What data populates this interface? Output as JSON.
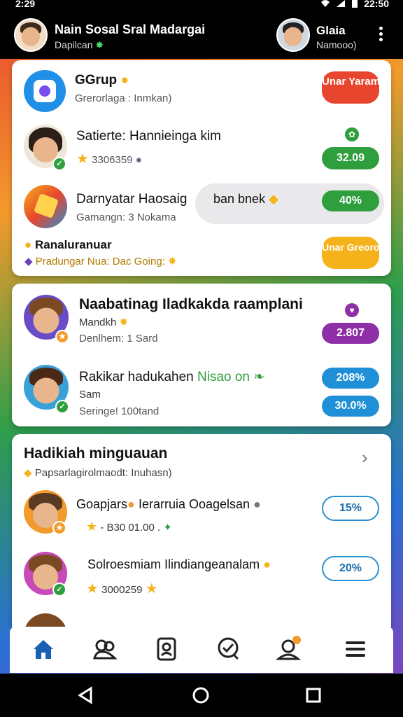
{
  "status": {
    "time": "2:29",
    "clock": "22:50"
  },
  "header": {
    "title": "Nain Sosal Sral Madargai",
    "subtitle": "Dapilcan",
    "user_name": "Glaia",
    "user_sub": "Namooo)"
  },
  "card1": {
    "rows": [
      {
        "title": "GGrup",
        "sub": "Grerorlaga : Inmkan)",
        "pill": "Unar Yarame",
        "pill_color": "#e8452e"
      },
      {
        "title": "Satierte: Hannieinga kim",
        "sub": "3306359",
        "pill": "32.09",
        "pill_color": "#2f9e3c"
      },
      {
        "title": "Darnyatar Haosaig",
        "bubble": "ban bnek",
        "sub": "Gamangn: 3 Nokama",
        "pill": "40%",
        "pill_color": "#2f9e3c"
      }
    ],
    "footer": {
      "title": "Ranaluranuar",
      "sub": "Pradungar Nua: Dac Going:",
      "pill": "Unar Greoro",
      "pill_color": "#f6b21b"
    }
  },
  "card2": {
    "rows": [
      {
        "title": "Naabatinag Iladkakda raamplani",
        "sub1": "Mandkh",
        "sub2": "Denlhem: 1 Sard",
        "pill": "2.807",
        "pill_color": "#8e2fa8"
      },
      {
        "title": "Rakikar hadukahen",
        "title_accent": "Nisao on",
        "sub1": "Sam",
        "sub2": "Seringe! 100tand",
        "pill": "208%",
        "pill2": "30.0%",
        "pill_color": "#1f8fd8"
      }
    ]
  },
  "card3": {
    "title": "Hadikiah minguauan",
    "sub": "Papsarlagirolmaodt: Inuhasn)",
    "rows": [
      {
        "title": "Goapjars",
        "title_rest": "Ierarruia Ooagelsan",
        "sub": "- B30 01.00 .",
        "pill": "15%"
      },
      {
        "title": "Solroesmiam Ilindiangeanalam",
        "sub": "3000259",
        "pill": "20%"
      }
    ]
  },
  "colors": {
    "accent_green": "#2f9e3c",
    "accent_red": "#e8452e",
    "accent_blue": "#1f8fd8",
    "accent_purple": "#8e2fa8",
    "accent_yellow": "#f6b21b",
    "nav_blue": "#1a5fb4"
  },
  "nav": [
    "home-icon",
    "groups-icon",
    "profile-card-icon",
    "check-badge-icon",
    "user-notify-icon",
    "menu-icon"
  ]
}
